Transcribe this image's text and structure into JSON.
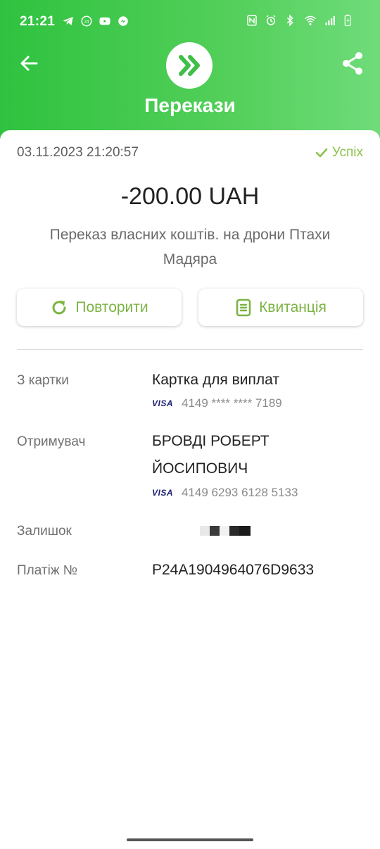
{
  "status_bar": {
    "time": "21:21",
    "left_icons": [
      "telegram-icon",
      "privat24-icon",
      "youtube-icon",
      "messenger-icon"
    ],
    "right_icons": [
      "nfc-icon",
      "alarm-icon",
      "bluetooth-icon",
      "wifi-icon",
      "signal-icon",
      "battery-icon"
    ]
  },
  "header": {
    "title": "Перекази",
    "logo_icon": "double-chevron-right-icon",
    "back_icon": "arrow-left-icon",
    "share_icon": "share-icon",
    "colors": {
      "gradient_start": "#2fc23f",
      "gradient_end": "#6fdc7a"
    }
  },
  "transaction": {
    "datetime": "03.11.2023 21:20:57",
    "status": "Успіх",
    "amount": "-200.00 UAH",
    "description": "Переказ власних коштів. на дрони Птахи Мадяра"
  },
  "actions": {
    "repeat_label": "Повторити",
    "receipt_label": "Квитанція",
    "accent_color": "#7cb342"
  },
  "details": {
    "from_card": {
      "label": "З картки",
      "value": "Картка для виплат",
      "card_brand": "VISA",
      "card_number": "4149 **** **** 7189"
    },
    "recipient": {
      "label": "Отримувач",
      "value": "БРОВДІ РОБЕРТ ЙОСИПОВИЧ",
      "card_brand": "VISA",
      "card_number": "4149 6293 6128 5133"
    },
    "balance": {
      "label": "Залишок"
    },
    "payment_no": {
      "label": "Платіж №",
      "value": "P24A1904964076D9633"
    }
  }
}
